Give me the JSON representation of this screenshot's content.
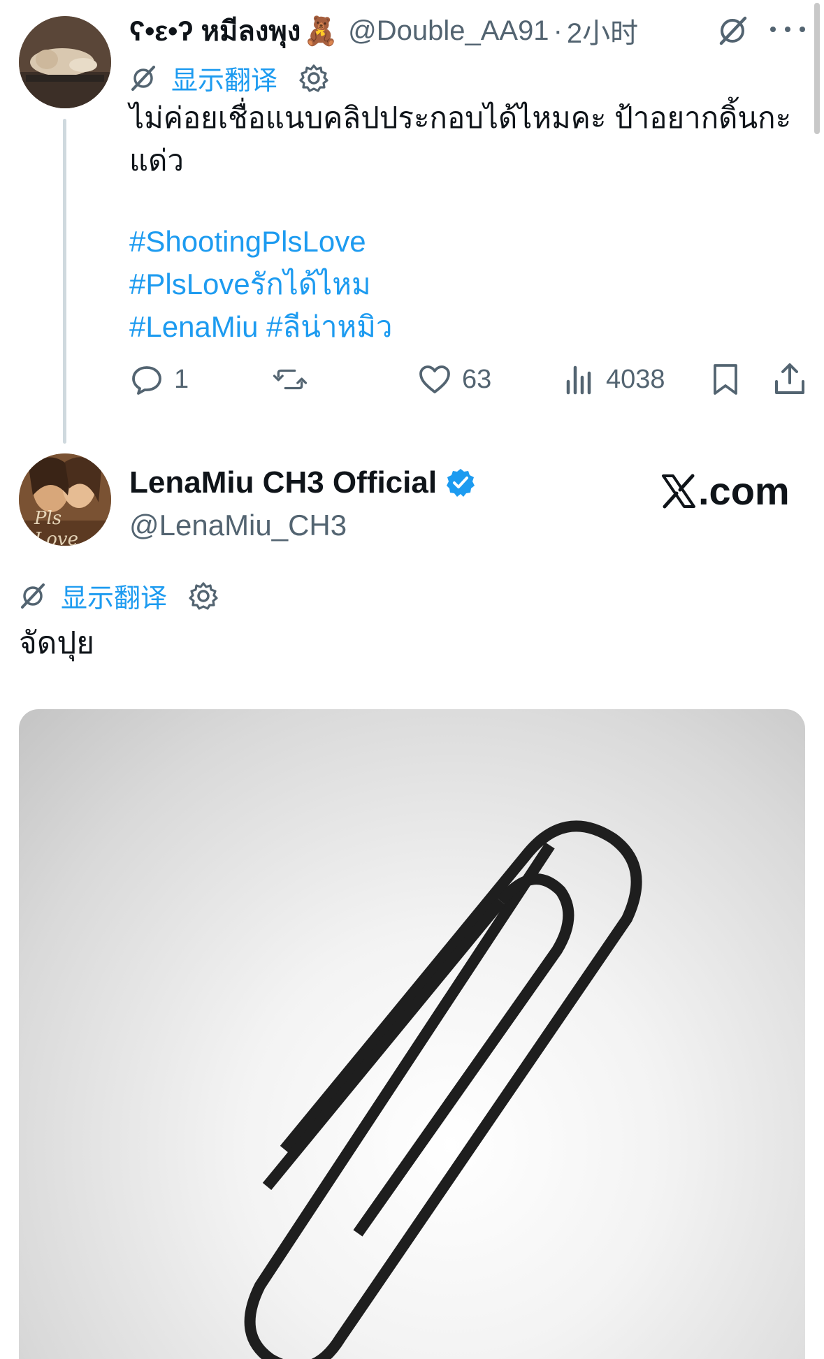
{
  "reply": {
    "display_name": "ʕ•ε•ʔ หมีลงพุง",
    "emoji": "🧸",
    "handle": "@Double_AA91",
    "separator": "·",
    "time": "2小时",
    "translate_label": "显示翻译",
    "text": "ไม่ค่อยเชื่อแนบคลิปประกอบได้ไหมคะ ป้าอยากดิ้นกะแด่ว",
    "hashtags": [
      "#ShootingPlsLove",
      "#PlsLoveรักได้ไหม",
      "#LenaMiu #ลีน่าหมิว"
    ],
    "counts": {
      "replies": "1",
      "likes": "63",
      "views": "4038"
    },
    "icons": [
      "grok-icon",
      "more-icon",
      "translate-icon",
      "gear-icon",
      "reply-icon",
      "retweet-icon",
      "like-icon",
      "views-icon",
      "bookmark-icon",
      "share-icon"
    ]
  },
  "main": {
    "display_name": "LenaMiu CH3 Official",
    "handle": "@LenaMiu_CH3",
    "avatar_caption": "Pls Love",
    "translate_label": "显示翻译",
    "text": "จัดปุย",
    "watermark": ".com",
    "icons": [
      "verified-badge-icon",
      "x-logo-icon",
      "translate-icon",
      "gear-icon"
    ],
    "media_subject": "paperclip"
  },
  "colors": {
    "link": "#1d9bf0",
    "secondary": "#536471",
    "primary_text": "#0f1419",
    "thread_line": "#cfd9de"
  }
}
